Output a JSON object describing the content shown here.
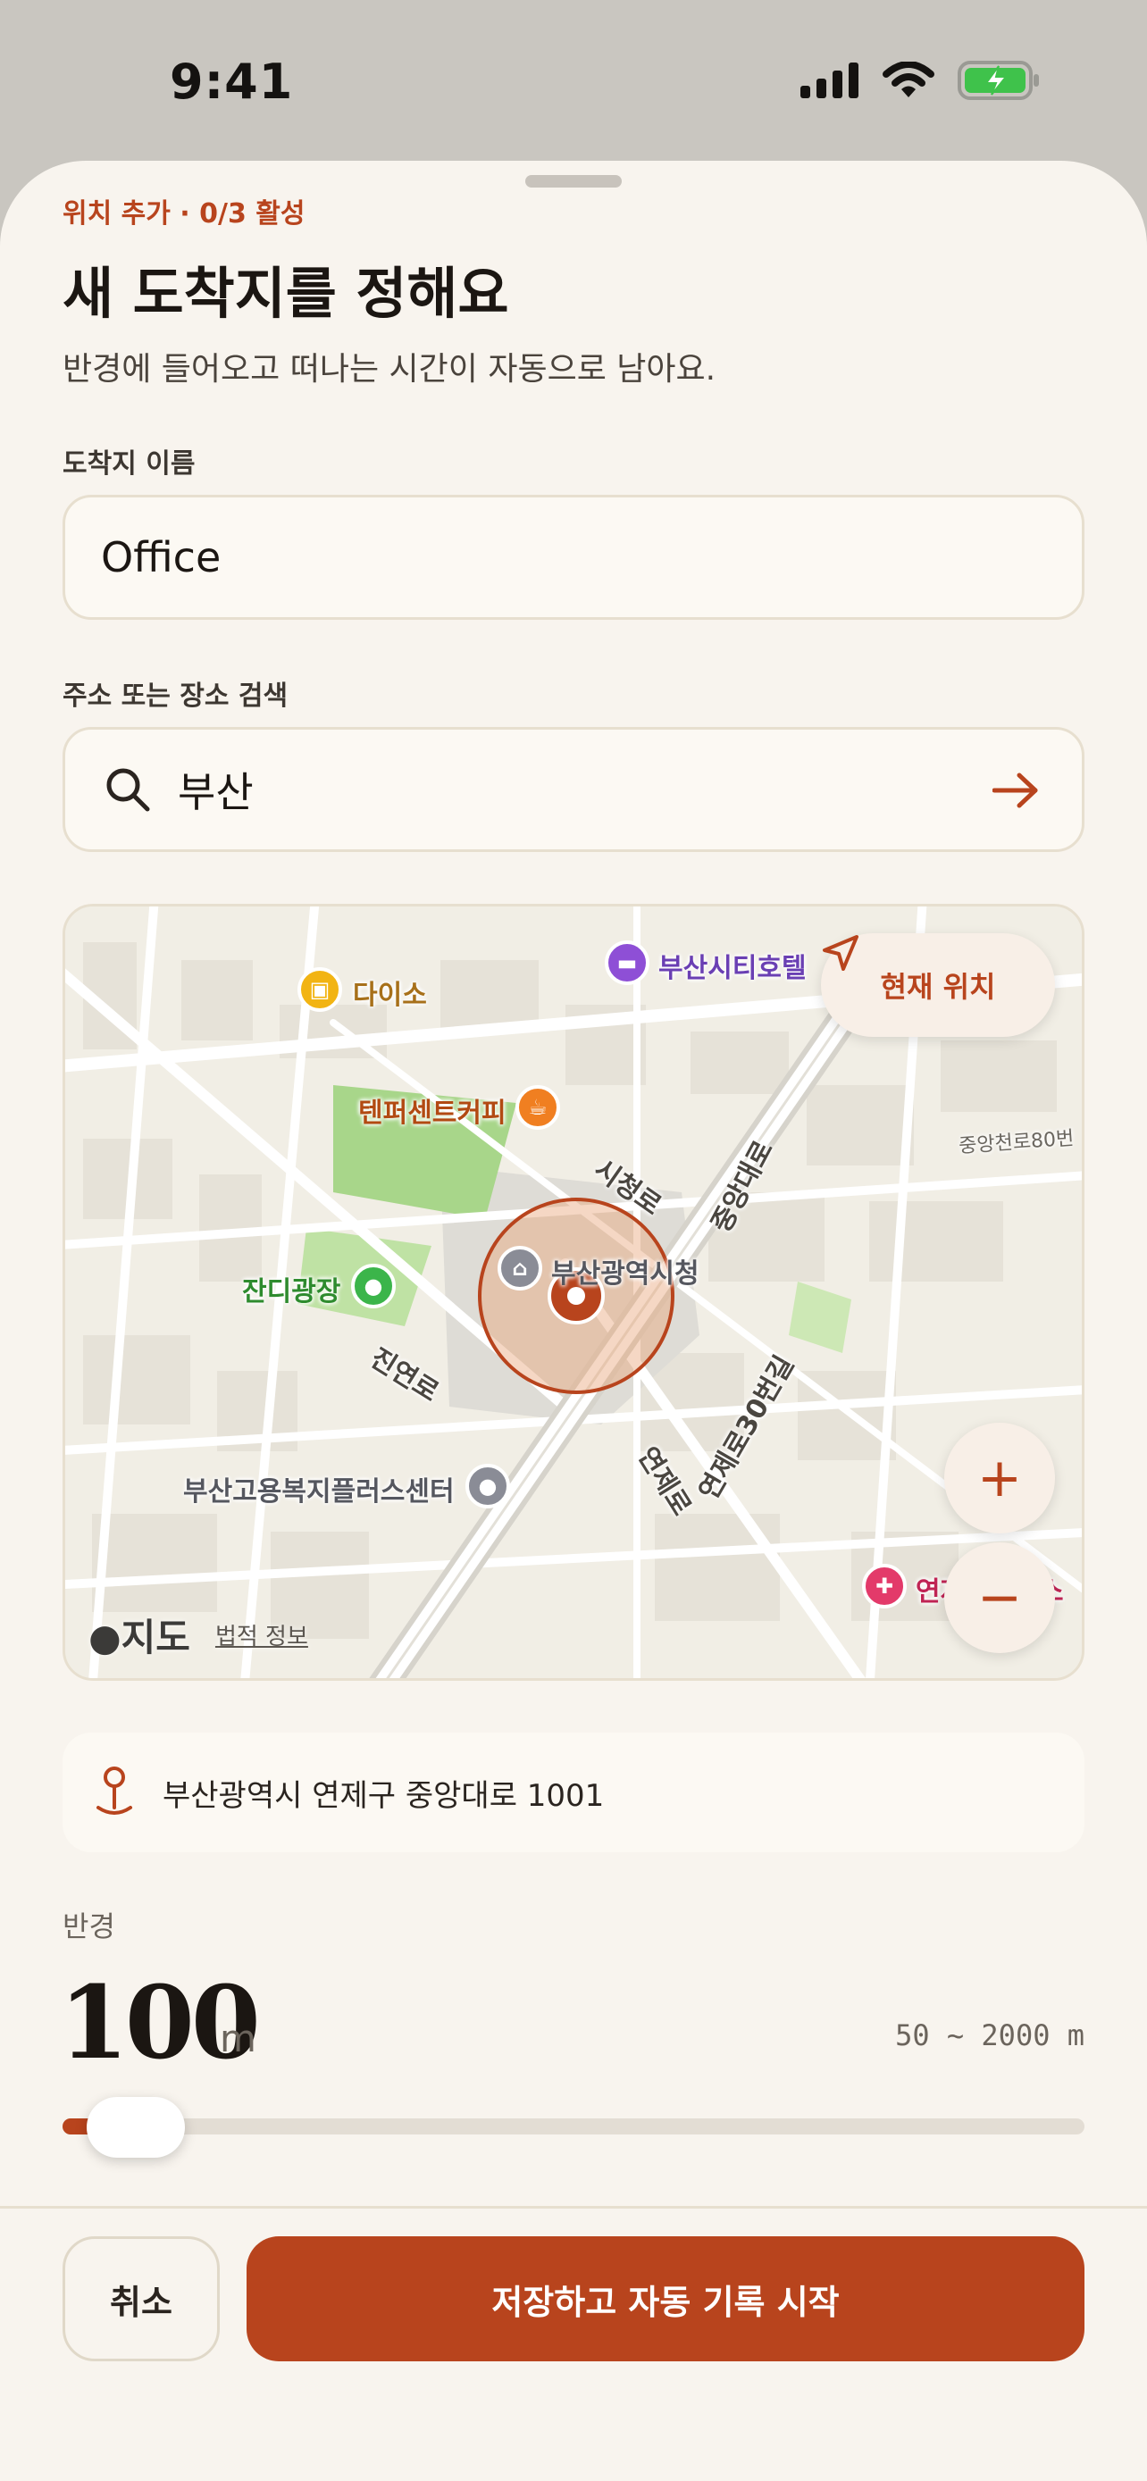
{
  "status_bar": {
    "time": "9:41"
  },
  "sheet": {
    "eyebrow": "위치 추가 · 0/3 활성",
    "title": "새 도착지를 정해요",
    "subtitle": "반경에 들어오고 떠나는 시간이 자동으로 남아요."
  },
  "name_field": {
    "label": "도착지 이름",
    "value": "Office"
  },
  "search_field": {
    "label": "주소 또는 장소 검색",
    "value": "부산"
  },
  "map": {
    "locate_label": "현재 위치",
    "zoom_in": "+",
    "zoom_out": "−",
    "attribution": "지도",
    "legal": "법적 정보",
    "places": {
      "hotel": "부산시티호텔",
      "daiso": "다이소",
      "cafe": "텐퍼센트커피",
      "plaza": "잔디광장",
      "cityhall": "부산광역시청",
      "center": "부산고용복지플러스센터",
      "hospital": "연제구보건소"
    },
    "roads": {
      "sicheong": "시청로",
      "jungang": "중앙대로",
      "jinyeon": "진연로",
      "yeonje30": "연제로30번길",
      "yeonje": "연제로",
      "jungang80": "중앙천로80번"
    }
  },
  "address": {
    "text": "부산광역시 연제구 중앙대로 1001"
  },
  "radius": {
    "label": "반경",
    "value": "100",
    "unit": "m",
    "range": "50 ~ 2000 m",
    "fraction": 0.026
  },
  "actions": {
    "cancel": "취소",
    "save": "저장하고 자동 기록 시작"
  },
  "colors": {
    "accent": "#b8441d",
    "background": "#f8f4ee",
    "field": "#fcf9f3"
  }
}
